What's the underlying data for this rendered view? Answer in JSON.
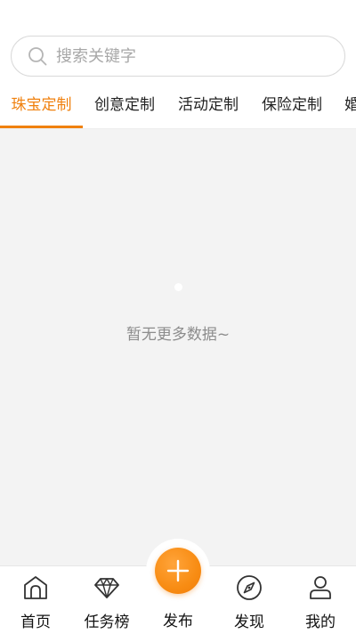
{
  "search": {
    "placeholder": "搜索关键字",
    "icon": "search-icon"
  },
  "tabs": [
    {
      "label": "珠宝定制",
      "active": true
    },
    {
      "label": "创意定制",
      "active": false
    },
    {
      "label": "活动定制",
      "active": false
    },
    {
      "label": "保险定制",
      "active": false
    },
    {
      "label": "婚",
      "active": false
    }
  ],
  "content": {
    "empty_text": "暂无更多数据~"
  },
  "tabbar": {
    "items": [
      {
        "label": "首页",
        "icon": "home-icon"
      },
      {
        "label": "任务榜",
        "icon": "diamond-icon"
      },
      {
        "label": "发布",
        "icon": "plus-icon"
      },
      {
        "label": "发现",
        "icon": "compass-icon"
      },
      {
        "label": "我的",
        "icon": "user-icon"
      }
    ]
  },
  "colors": {
    "accent": "#f0810f",
    "background": "#f3f3f3",
    "empty_text": "#8c8c8c"
  }
}
